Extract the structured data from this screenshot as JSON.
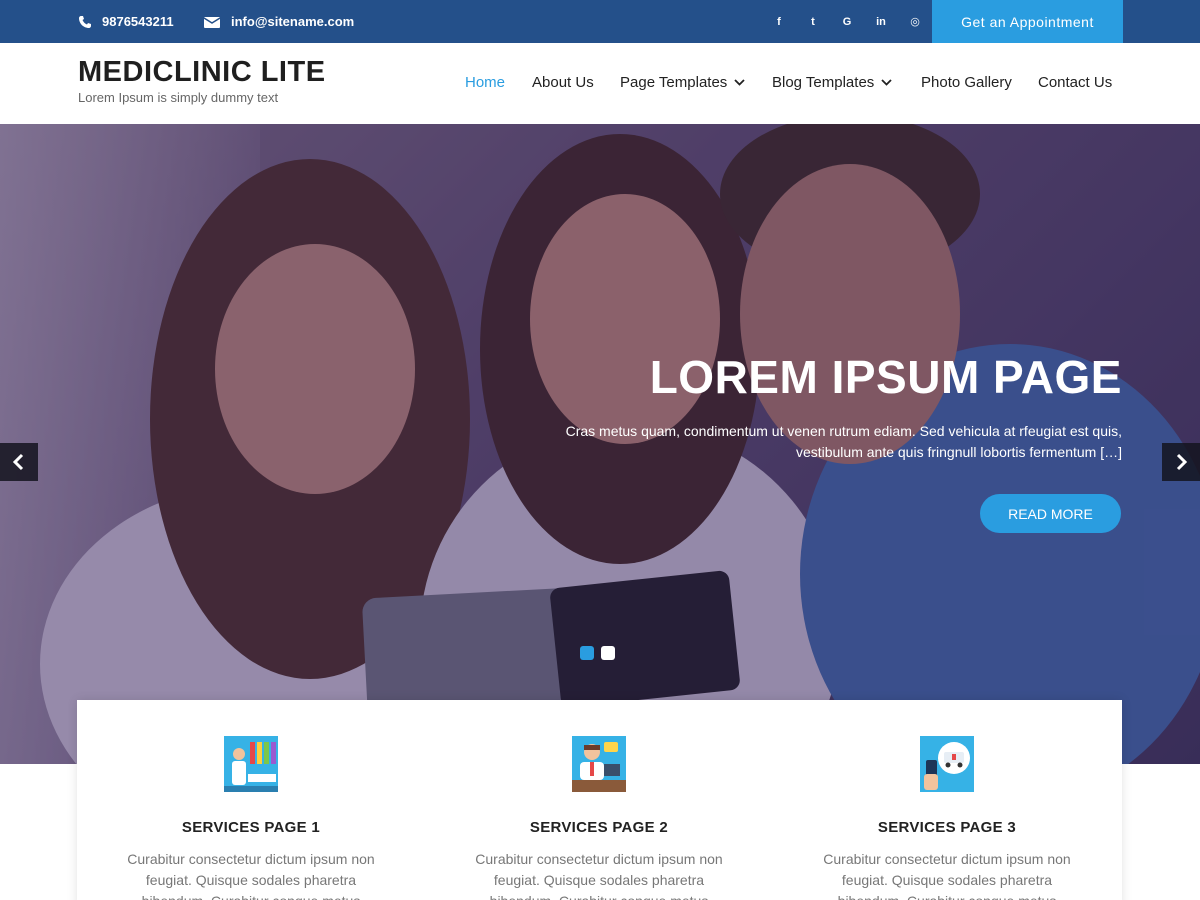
{
  "topbar": {
    "phone": "9876543211",
    "email": "info@sitename.com",
    "social": [
      {
        "icon": "facebook-icon",
        "glyph": "f"
      },
      {
        "icon": "twitter-icon",
        "glyph": "t"
      },
      {
        "icon": "google-plus-icon",
        "glyph": "G"
      },
      {
        "icon": "linkedin-icon",
        "glyph": "in"
      },
      {
        "icon": "instagram-icon",
        "glyph": "◎"
      }
    ],
    "appointment_label": "Get an Appointment"
  },
  "header": {
    "site_title": "MEDICLINIC LITE",
    "tagline": "Lorem Ipsum is simply dummy text",
    "nav": [
      {
        "label": "Home",
        "active": true
      },
      {
        "label": "About Us"
      },
      {
        "label": "Page Templates",
        "dropdown": true
      },
      {
        "label": "Blog Templates",
        "dropdown": true
      },
      {
        "label": "Photo Gallery"
      },
      {
        "label": "Contact Us"
      }
    ]
  },
  "hero": {
    "title": "LOREM IPSUM PAGE",
    "text": "Cras metus quam, condimentum ut venen rutrum ediam. Sed vehicula at rfeugiat est quis, vestibulum ante quis fringnull lobortis fermentum […]",
    "button": "READ MORE",
    "slides_total": 2,
    "active_slide": 1
  },
  "services": [
    {
      "title": "SERVICES PAGE 1",
      "text": "Curabitur consectetur dictum ipsum non feugiat. Quisque sodales pharetra bibendum. Curabitur congue metus"
    },
    {
      "title": "SERVICES PAGE 2",
      "text": "Curabitur consectetur dictum ipsum non feugiat. Quisque sodales pharetra bibendum. Curabitur congue metus"
    },
    {
      "title": "SERVICES PAGE 3",
      "text": "Curabitur consectetur dictum ipsum non feugiat. Quisque sodales pharetra bibendum. Curabitur congue metus"
    }
  ],
  "colors": {
    "topbar": "#24508a",
    "accent": "#2a9de0",
    "text_dark": "#222222",
    "text_muted": "#777777"
  }
}
